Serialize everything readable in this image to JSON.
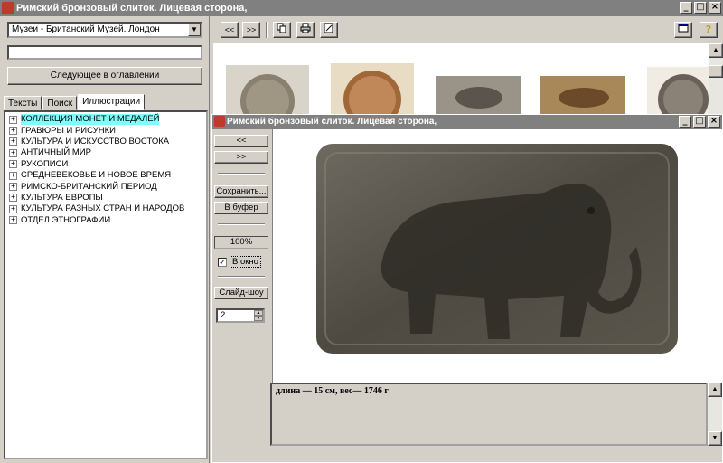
{
  "app": {
    "title": "Римский бронзовый слиток. Лицевая сторона,"
  },
  "left": {
    "museum_select": "Музеи - Британский Музей. Лондон",
    "search_value": "",
    "next_button": "Следующее в оглавлении",
    "tabs": [
      {
        "label": "Тексты"
      },
      {
        "label": "Поиск"
      },
      {
        "label": "Иллюстрации",
        "active": true
      }
    ],
    "tree": [
      {
        "label": "КОЛЛЕКЦИЯ МОНЕТ И МЕДАЛЕЙ",
        "selected": true
      },
      {
        "label": "ГРАВЮРЫ И РИСУНКИ"
      },
      {
        "label": "КУЛЬТУРА И ИСКУССТВО ВОСТОКА"
      },
      {
        "label": "АНТИЧНЫЙ МИР"
      },
      {
        "label": "РУКОПИСИ"
      },
      {
        "label": "СРЕДНЕВЕКОВЬЕ И НОВОЕ ВРЕМЯ"
      },
      {
        "label": "РИМСКО-БРИТАНСКИЙ ПЕРИОД"
      },
      {
        "label": "КУЛЬТУРА ЕВРОПЫ"
      },
      {
        "label": "КУЛЬТУРА РАЗНЫХ СТРАН И НАРОДОВ"
      },
      {
        "label": "ОТДЕЛ ЭТНОГРАФИИ"
      }
    ]
  },
  "toolbar": {
    "prev": "<<",
    "next": ">>"
  },
  "viewer": {
    "title": "Римский бронзовый слиток. Лицевая сторона,",
    "prev": "<<",
    "next": ">>",
    "save": "Сохранить...",
    "copy": "В буфер",
    "zoom": "100%",
    "fit_label": "В окно",
    "fit_checked": true,
    "slideshow": "Слайд-шоу",
    "interval": "2",
    "description": "длина — 15  см, вес— 1746 г"
  },
  "colors": {
    "titlebar": "#808080",
    "selection": "#7fffff",
    "face": "#d4d0c8"
  }
}
